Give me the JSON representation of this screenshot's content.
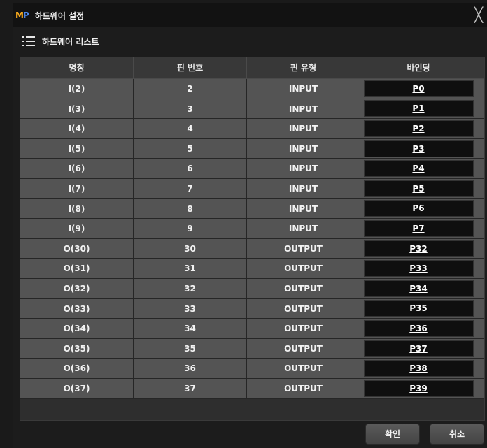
{
  "window": {
    "logo_m": "M",
    "logo_p": "P",
    "title": "하드웨어 설정",
    "close": "╳"
  },
  "section": {
    "title": "하드웨어 리스트"
  },
  "table": {
    "headers": [
      "명칭",
      "핀 번호",
      "핀 유형",
      "바인딩"
    ],
    "rows": [
      {
        "name": "I(2)",
        "pin": "2",
        "type": "INPUT",
        "binding": "P0"
      },
      {
        "name": "I(3)",
        "pin": "3",
        "type": "INPUT",
        "binding": "P1"
      },
      {
        "name": "I(4)",
        "pin": "4",
        "type": "INPUT",
        "binding": "P2"
      },
      {
        "name": "I(5)",
        "pin": "5",
        "type": "INPUT",
        "binding": "P3"
      },
      {
        "name": "I(6)",
        "pin": "6",
        "type": "INPUT",
        "binding": "P4"
      },
      {
        "name": "I(7)",
        "pin": "7",
        "type": "INPUT",
        "binding": "P5"
      },
      {
        "name": "I(8)",
        "pin": "8",
        "type": "INPUT",
        "binding": "P6"
      },
      {
        "name": "I(9)",
        "pin": "9",
        "type": "INPUT",
        "binding": "P7"
      },
      {
        "name": "O(30)",
        "pin": "30",
        "type": "OUTPUT",
        "binding": "P32"
      },
      {
        "name": "O(31)",
        "pin": "31",
        "type": "OUTPUT",
        "binding": "P33"
      },
      {
        "name": "O(32)",
        "pin": "32",
        "type": "OUTPUT",
        "binding": "P34"
      },
      {
        "name": "O(33)",
        "pin": "33",
        "type": "OUTPUT",
        "binding": "P35"
      },
      {
        "name": "O(34)",
        "pin": "34",
        "type": "OUTPUT",
        "binding": "P36"
      },
      {
        "name": "O(35)",
        "pin": "35",
        "type": "OUTPUT",
        "binding": "P37"
      },
      {
        "name": "O(36)",
        "pin": "36",
        "type": "OUTPUT",
        "binding": "P38"
      },
      {
        "name": "O(37)",
        "pin": "37",
        "type": "OUTPUT",
        "binding": "P39"
      }
    ]
  },
  "footer": {
    "ok_label": "확인",
    "cancel_label": "취소"
  },
  "colors": {
    "logo_m": "#f4a81e",
    "logo_p": "#4a86e8",
    "row_bg": "#545454",
    "binding_bg": "#0f0f0f"
  }
}
